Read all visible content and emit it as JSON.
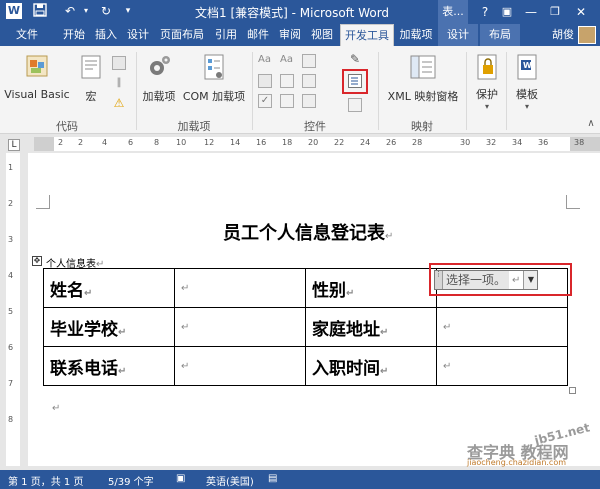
{
  "titlebar": {
    "title": "文档1 [兼容模式] - Microsoft Word",
    "context_title": "表...",
    "help": "?",
    "minimize": "—",
    "close": "✕"
  },
  "tabs": [
    {
      "label": "文件"
    },
    {
      "label": "开始"
    },
    {
      "label": "插入"
    },
    {
      "label": "设计"
    },
    {
      "label": "页面布局"
    },
    {
      "label": "引用"
    },
    {
      "label": "邮件"
    },
    {
      "label": "审阅"
    },
    {
      "label": "视图"
    },
    {
      "label": "开发工具"
    },
    {
      "label": "加载项"
    },
    {
      "label": "设计"
    },
    {
      "label": "布局"
    }
  ],
  "user": {
    "name": "胡俊"
  },
  "ribbon": {
    "code": {
      "visual_basic": "Visual Basic",
      "macro": "宏",
      "label": "代码"
    },
    "addins": {
      "addins": "加载项",
      "com_addins": "COM 加载项",
      "label": "加载项"
    },
    "controls": {
      "label": "控件"
    },
    "mapping": {
      "xml_pane": "XML 映射窗格",
      "label": "映射"
    },
    "protect": {
      "label": "保护"
    },
    "templates": {
      "label": "模板"
    }
  },
  "ruler": {
    "ticks": [
      "2",
      "4",
      "6",
      "8",
      "10",
      "12",
      "14",
      "16",
      "18",
      "20",
      "22",
      "24",
      "26",
      "28",
      "30",
      "32",
      "34",
      "36",
      "38"
    ],
    "left_ticks": [
      "L",
      "4",
      "2"
    ],
    "vticks": [
      "1",
      "2",
      "3",
      "4",
      "5",
      "6",
      "7",
      "8"
    ]
  },
  "document": {
    "title": "员工个人信息登记表",
    "caption": "个人信息表",
    "para_mark": "↵",
    "table": [
      [
        {
          "text": "姓名",
          "label": true
        },
        {
          "text": "",
          "label": false
        },
        {
          "text": "性别",
          "label": true
        },
        {
          "text": "",
          "label": false
        }
      ],
      [
        {
          "text": "毕业学校",
          "label": true
        },
        {
          "text": "",
          "label": false
        },
        {
          "text": "家庭地址",
          "label": true
        },
        {
          "text": "",
          "label": false
        }
      ],
      [
        {
          "text": "联系电话",
          "label": true
        },
        {
          "text": "",
          "label": false
        },
        {
          "text": "入职时间",
          "label": true
        },
        {
          "text": "",
          "label": false
        }
      ]
    ],
    "content_control": {
      "placeholder": "选择一项。"
    }
  },
  "statusbar": {
    "page": "第 1 页，共 1 页",
    "words": "5/39 个字",
    "language": "英语(美国)"
  },
  "watermark": {
    "site": "jb51.net",
    "brand": "查字典 教程网",
    "url": "jiaocheng.chazidian.com"
  },
  "colors": {
    "accent": "#2b579a",
    "highlight": "#d9262b"
  }
}
